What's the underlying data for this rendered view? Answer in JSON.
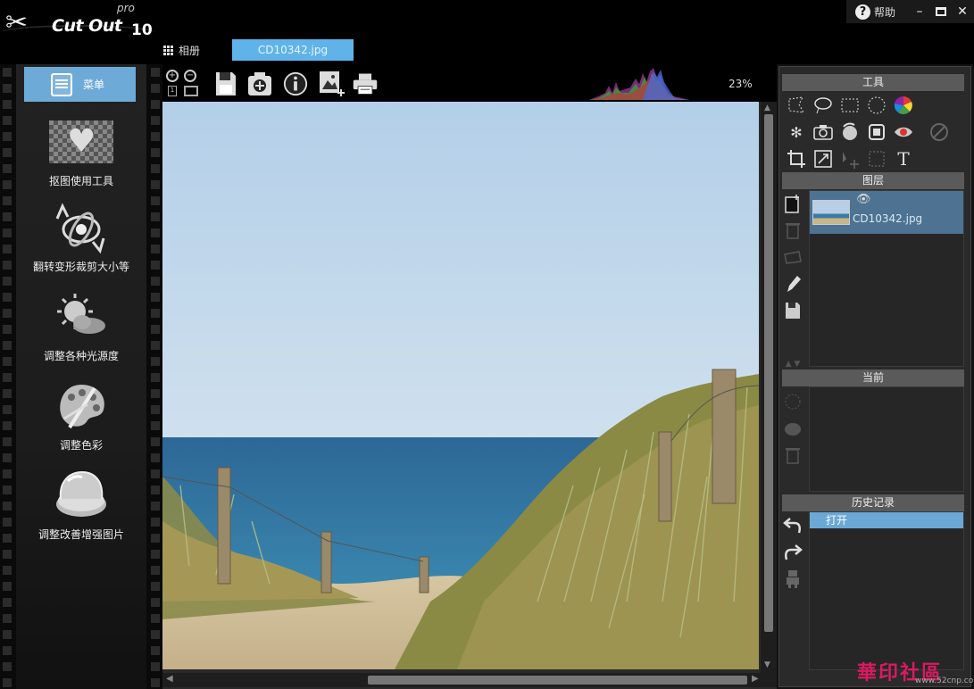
{
  "app": {
    "logo_name": "Cut Out",
    "logo_pro": "pro",
    "logo_version": "10"
  },
  "window": {
    "help_label": "帮助",
    "minimize": "–",
    "close": "✕"
  },
  "tabs": {
    "album_label": "相册",
    "file_tab_label": "CD10342.jpg"
  },
  "sidebar": {
    "menu_label": "菜单",
    "items": [
      {
        "label": "抠图使用工具",
        "icon": "heart-cutout-icon"
      },
      {
        "label": "翻转变形裁剪大小等",
        "icon": "transform-icon"
      },
      {
        "label": "调整各种光源度",
        "icon": "light-adjust-icon"
      },
      {
        "label": "调整色彩",
        "icon": "color-palette-icon"
      },
      {
        "label": "调整改善增强图片",
        "icon": "enhance-compact-icon"
      }
    ]
  },
  "toolbar": {
    "zoom_percent": "23%",
    "icons": [
      "zoom-in-icon",
      "zoom-out-icon",
      "save-icon",
      "add-to-album-icon",
      "info-icon",
      "export-image-icon",
      "print-icon"
    ]
  },
  "right_panel": {
    "tools_header": "工具",
    "layers_header": "图层",
    "current_header": "当前",
    "history_header": "历史记录",
    "layer_name": "CD10342.jpg",
    "history_items": [
      "打开"
    ]
  },
  "watermark": {
    "text": "華印社區",
    "sub": "www.52cnp.com"
  },
  "colors": {
    "accent_blue": "#6eaad8",
    "tab_blue": "#5fb3e8",
    "layer_selected": "#4e7392"
  }
}
